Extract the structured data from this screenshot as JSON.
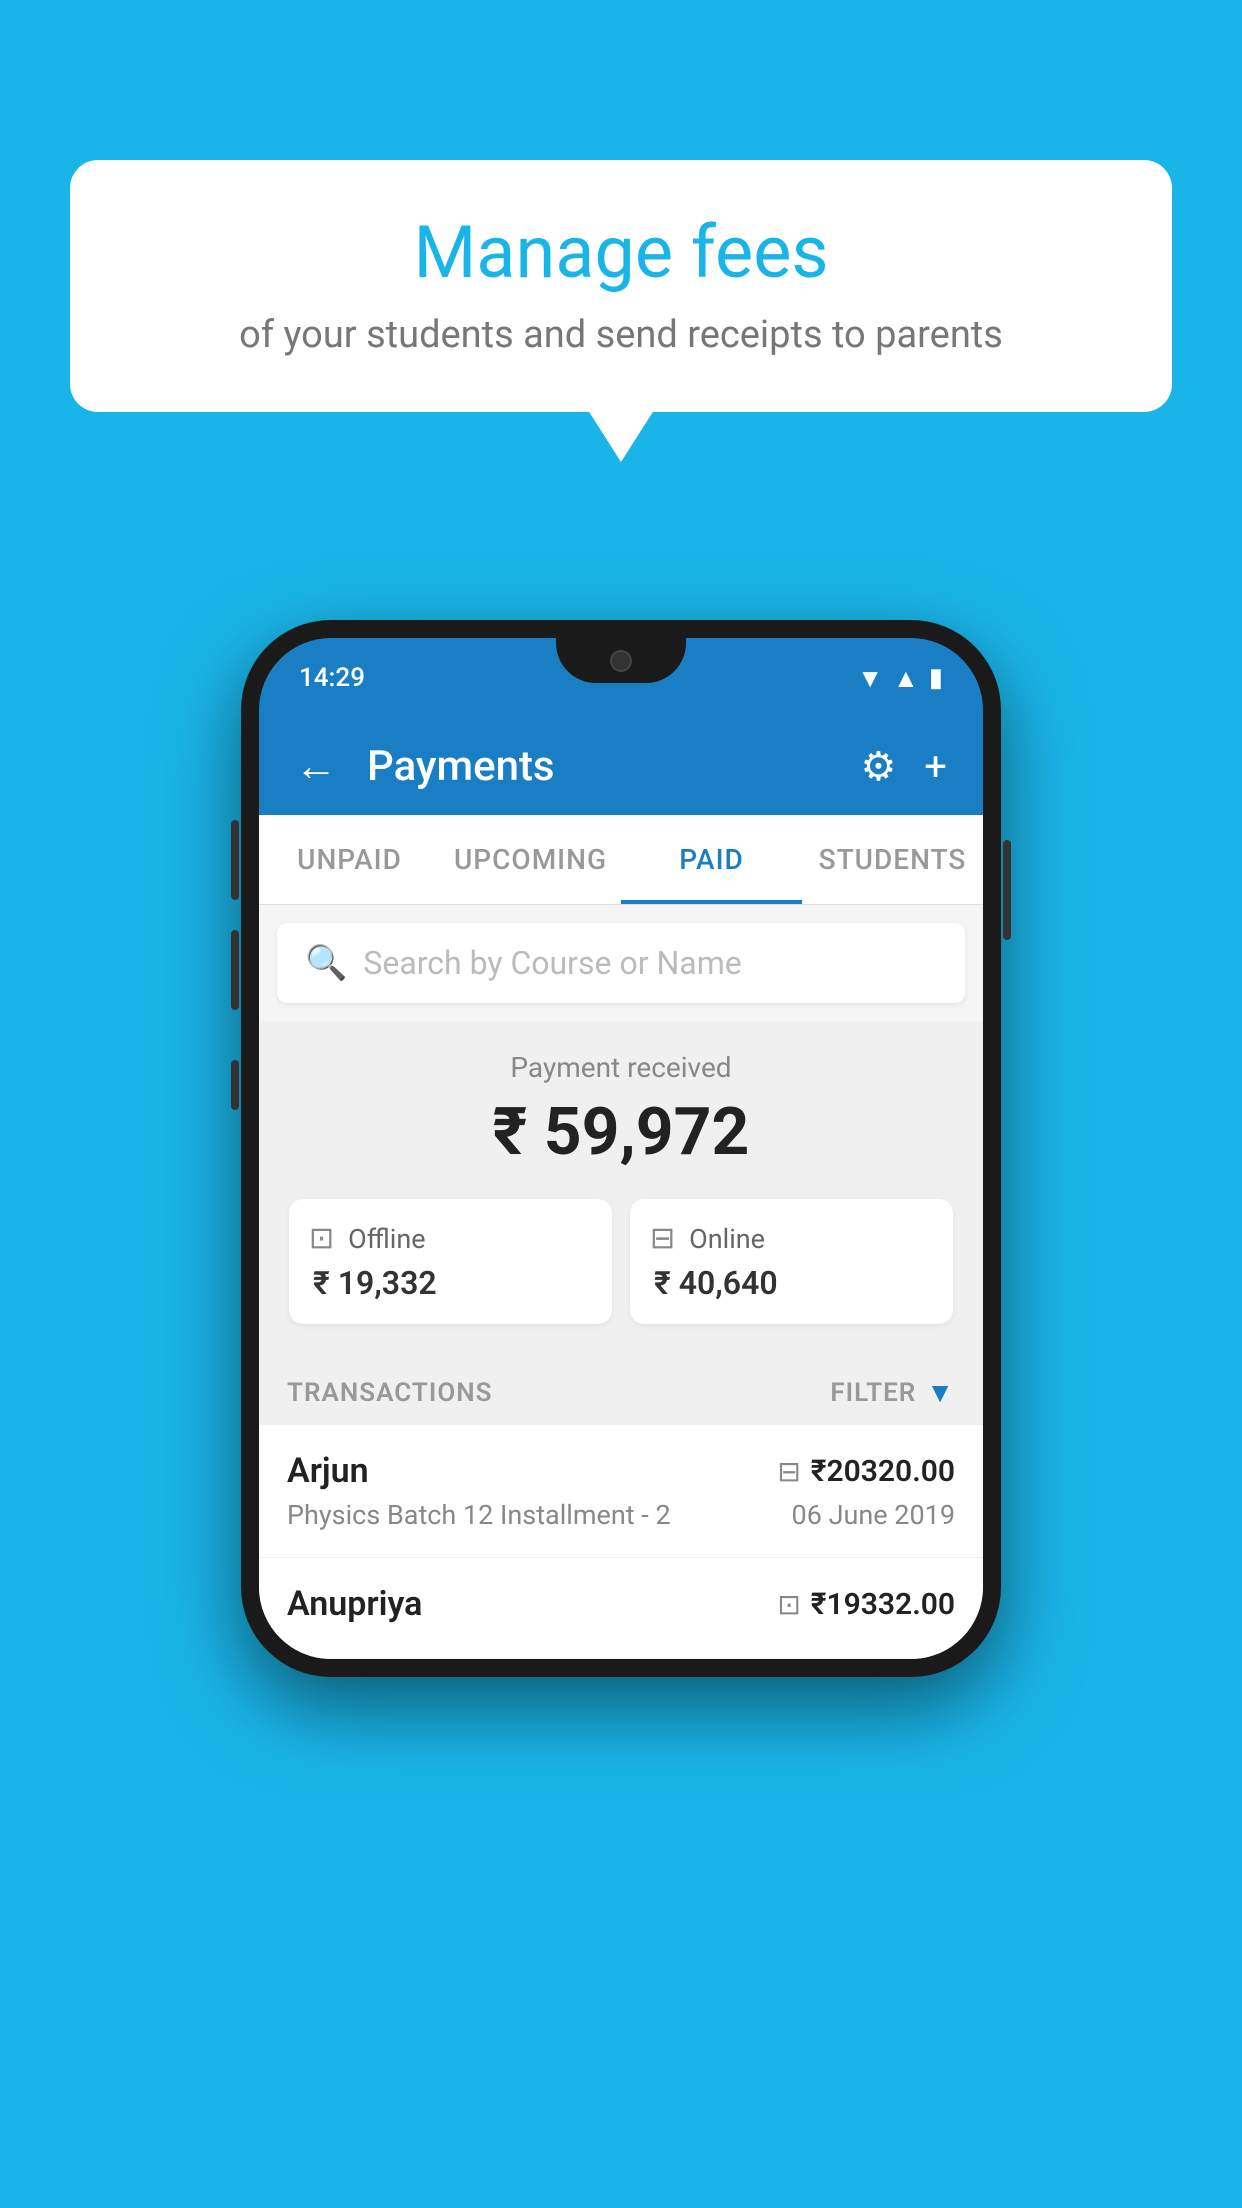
{
  "background_color": "#1ab5e8",
  "bubble": {
    "title": "Manage fees",
    "subtitle": "of your students and send receipts to parents"
  },
  "phone": {
    "status_bar": {
      "time": "14:29"
    },
    "header": {
      "title": "Payments",
      "back_label": "←",
      "plus_label": "+",
      "gear_label": "⚙"
    },
    "tabs": [
      {
        "label": "UNPAID",
        "active": false
      },
      {
        "label": "UPCOMING",
        "active": false
      },
      {
        "label": "PAID",
        "active": true
      },
      {
        "label": "STUDENTS",
        "active": false
      }
    ],
    "search": {
      "placeholder": "Search by Course or Name"
    },
    "payment_summary": {
      "received_label": "Payment received",
      "total_amount": "₹ 59,972",
      "offline": {
        "label": "Offline",
        "amount": "₹ 19,332"
      },
      "online": {
        "label": "Online",
        "amount": "₹ 40,640"
      }
    },
    "transactions": {
      "section_label": "TRANSACTIONS",
      "filter_label": "FILTER",
      "rows": [
        {
          "name": "Arjun",
          "amount": "₹20320.00",
          "payment_type": "online",
          "course": "Physics Batch 12 Installment - 2",
          "date": "06 June 2019"
        },
        {
          "name": "Anupriya",
          "amount": "₹19332.00",
          "payment_type": "offline",
          "course": "",
          "date": ""
        }
      ]
    }
  }
}
